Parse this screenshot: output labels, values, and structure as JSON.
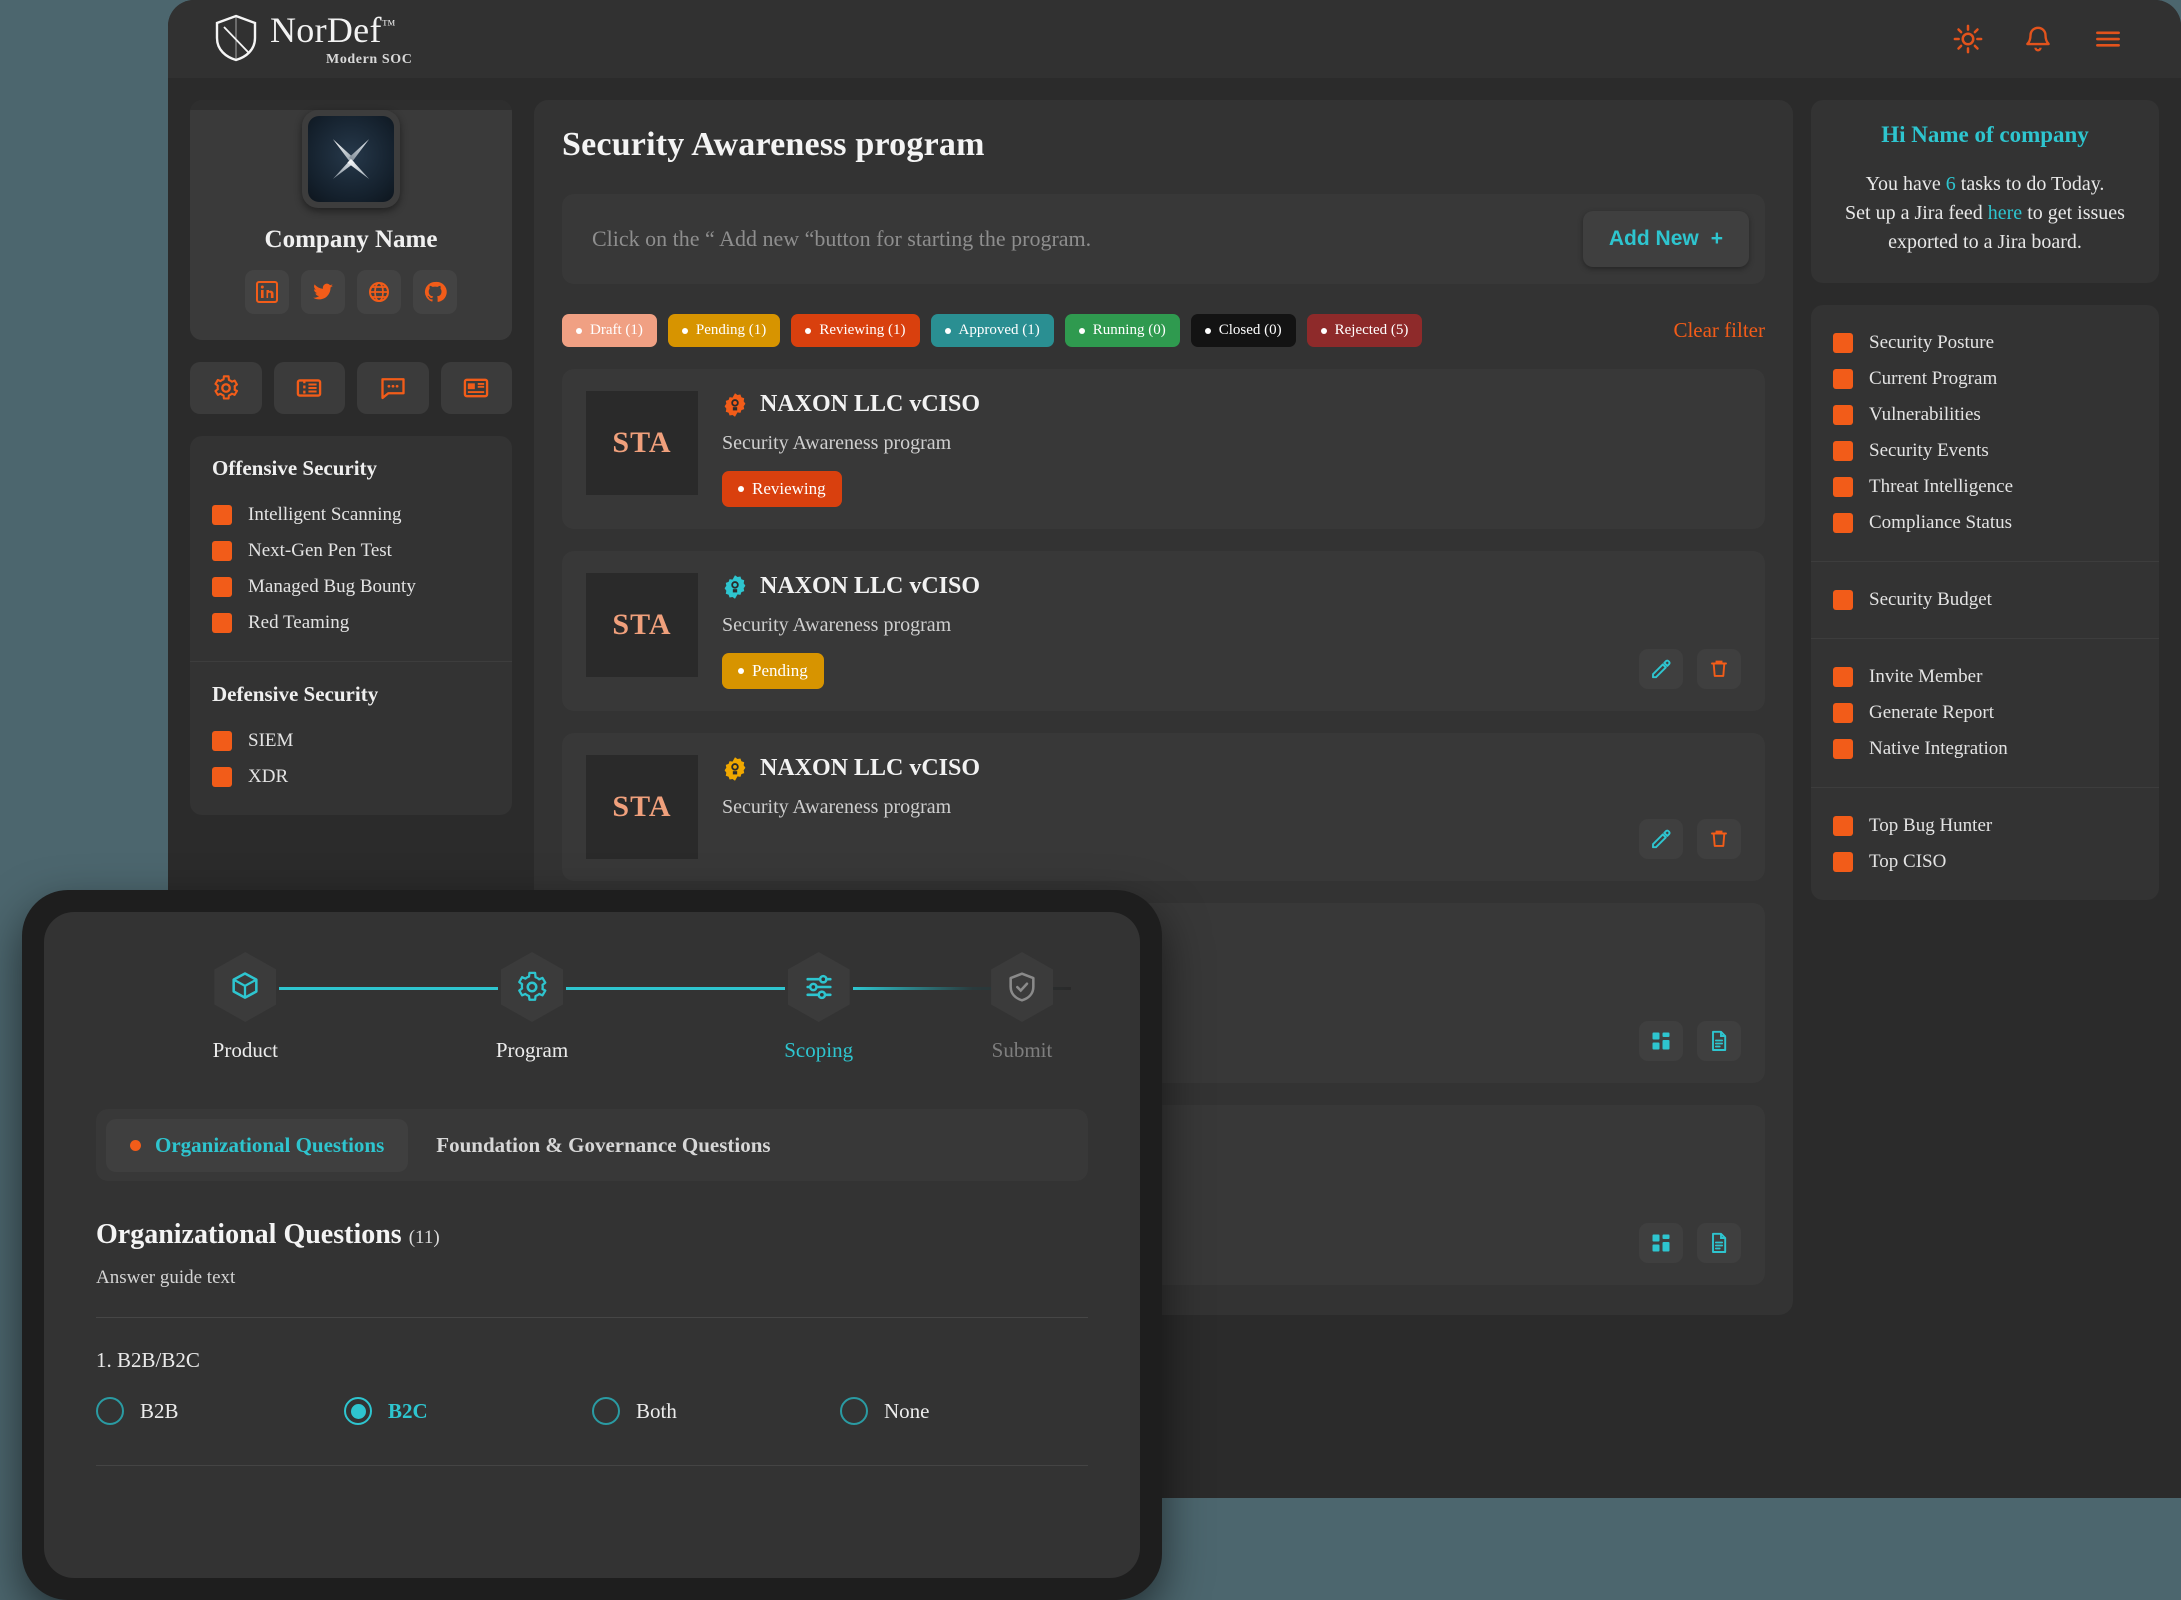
{
  "brand": {
    "name": "NorDef",
    "tm": "™",
    "tagline": "Modern SOC"
  },
  "topbar": {
    "theme_toggle": "sun-icon",
    "notifications": "bell-icon",
    "menu": "hamburger-menu-icon"
  },
  "company": {
    "name": "Company Name",
    "avatar_alt": "company-logo",
    "socials": [
      {
        "name": "linkedin",
        "label": "LinkedIn"
      },
      {
        "name": "twitter",
        "label": "Twitter"
      },
      {
        "name": "website",
        "label": "Website"
      },
      {
        "name": "github",
        "label": "GitHub"
      }
    ]
  },
  "quick_actions": [
    {
      "name": "settings",
      "label": "Settings"
    },
    {
      "name": "tickets",
      "label": "Tickets"
    },
    {
      "name": "chat",
      "label": "Chat"
    },
    {
      "name": "contact-card",
      "label": "Contact Card"
    }
  ],
  "sidebar": {
    "groups": [
      {
        "title": "Offensive Security",
        "items": [
          "Intelligent Scanning",
          "Next-Gen Pen Test",
          "Managed Bug Bounty",
          "Red Teaming"
        ]
      },
      {
        "title": "Defensive Security",
        "items": [
          "SIEM",
          "XDR"
        ]
      }
    ]
  },
  "main": {
    "page_title": "Security Awareness program",
    "hint_text": "Click on the “ Add new “button for starting the program.",
    "add_new_label": "Add New",
    "add_new_plus": "+",
    "clear_filter": "Clear filter",
    "filters": [
      {
        "label": "Draft (1)",
        "color": "#f0a083"
      },
      {
        "label": "Pending (1)",
        "color": "#d79400"
      },
      {
        "label": "Reviewing (1)",
        "color": "#d9400e"
      },
      {
        "label": "Approved (1)",
        "color": "#2a8f92"
      },
      {
        "label": "Running (0)",
        "color": "#2f9a4f"
      },
      {
        "label": "Closed (0)",
        "color": "#131313"
      },
      {
        "label": "Rejected (5)",
        "color": "#8e2a2a"
      }
    ],
    "programs": [
      {
        "thumb": "STA",
        "org": "NAXON LLC vCISO",
        "badge_color": "#f25c19",
        "subtitle": "Security Awareness program",
        "status": "Reviewing",
        "status_color": "#d9400e",
        "actions": []
      },
      {
        "thumb": "STA",
        "org": "NAXON LLC vCISO",
        "badge_color": "#2ec5cf",
        "subtitle": "Security Awareness program",
        "status": "Pending",
        "status_color": "#d79400",
        "actions": [
          "edit-icon",
          "delete-icon"
        ]
      },
      {
        "thumb": "STA",
        "org": "NAXON LLC vCISO",
        "badge_color": "#f0a800",
        "subtitle": "Security Awareness program",
        "status": "",
        "status_color": "",
        "actions": [
          "edit-icon",
          "delete-icon"
        ]
      },
      {
        "thumb": "",
        "org": "",
        "badge_color": "#f25c19",
        "subtitle": "",
        "status": "",
        "status_color": "",
        "actions": [
          "dashboard-icon",
          "report-icon"
        ]
      },
      {
        "thumb": "",
        "org": "",
        "badge_color": "#f25c19",
        "subtitle": "",
        "status": "",
        "status_color": "",
        "actions": [
          "dashboard-icon",
          "report-icon"
        ]
      }
    ]
  },
  "right": {
    "greeting_title": "Hi Name of company",
    "greeting_line1_a": "You have ",
    "greeting_count": "6",
    "greeting_line1_b": " tasks to do Today.",
    "greeting_line2_a": "Set up a Jira feed ",
    "greeting_link": "here",
    "greeting_line2_b": " to get issues",
    "greeting_line3": "exported to a Jira board.",
    "groups": [
      {
        "items": [
          "Security Posture",
          "Current Program",
          "Vulnerabilities",
          "Security Events",
          "Threat Intelligence",
          "Compliance Status"
        ]
      },
      {
        "items": [
          "Security Budget"
        ]
      },
      {
        "items": [
          "Invite Member",
          "Generate Report",
          "Native Integration"
        ]
      },
      {
        "items": [
          "Top Bug Hunter",
          "Top CISO"
        ]
      }
    ]
  },
  "modal": {
    "steps": [
      {
        "label": "Product",
        "icon": "cube-icon",
        "state": "done"
      },
      {
        "label": "Program",
        "icon": "gear-icon",
        "state": "done"
      },
      {
        "label": "Scoping",
        "icon": "sliders-icon",
        "state": "active"
      },
      {
        "label": "Submit",
        "icon": "shield-check-icon",
        "state": "inactive"
      }
    ],
    "tabs": [
      {
        "label": "Organizational Questions",
        "active": true
      },
      {
        "label": "Foundation & Governance Questions",
        "active": false
      }
    ],
    "section_title": "Organizational Questions",
    "section_count": "(11)",
    "answer_guide": "Answer guide text",
    "questions": [
      {
        "number": "1.",
        "text": "B2B/B2C",
        "options": [
          {
            "label": "B2B",
            "selected": false
          },
          {
            "label": "B2C",
            "selected": true
          },
          {
            "label": "Both",
            "selected": false
          },
          {
            "label": "None",
            "selected": false
          }
        ]
      }
    ]
  },
  "colors": {
    "accent_orange": "#f25c19",
    "accent_cyan": "#2ec5cf",
    "page_bg": "#4c666e",
    "panel": "#333333"
  }
}
